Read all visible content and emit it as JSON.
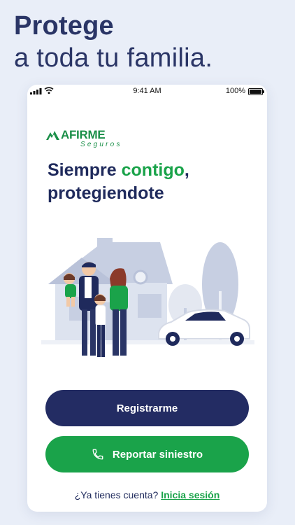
{
  "headline": {
    "line1": "Protege",
    "line2": "a toda tu familia."
  },
  "status_bar": {
    "time": "9:41 AM",
    "battery": "100%"
  },
  "brand": {
    "name": "AFIRME",
    "subname": "Seguros"
  },
  "tagline": {
    "prefix": "Siempre",
    "accent": "contigo",
    "suffix": ",",
    "line2": "protegiendote"
  },
  "buttons": {
    "register": "Registrarme",
    "report": "Reportar siniestro"
  },
  "login": {
    "prompt": "¿Ya tienes cuenta?",
    "link": "Inicia sesión"
  },
  "colors": {
    "background": "#e9eef8",
    "navy": "#232c63",
    "green": "#1aa34a"
  },
  "icons": [
    "signal-icon",
    "wifi-icon",
    "battery-icon",
    "afirme-logo-icon",
    "phone-icon"
  ]
}
